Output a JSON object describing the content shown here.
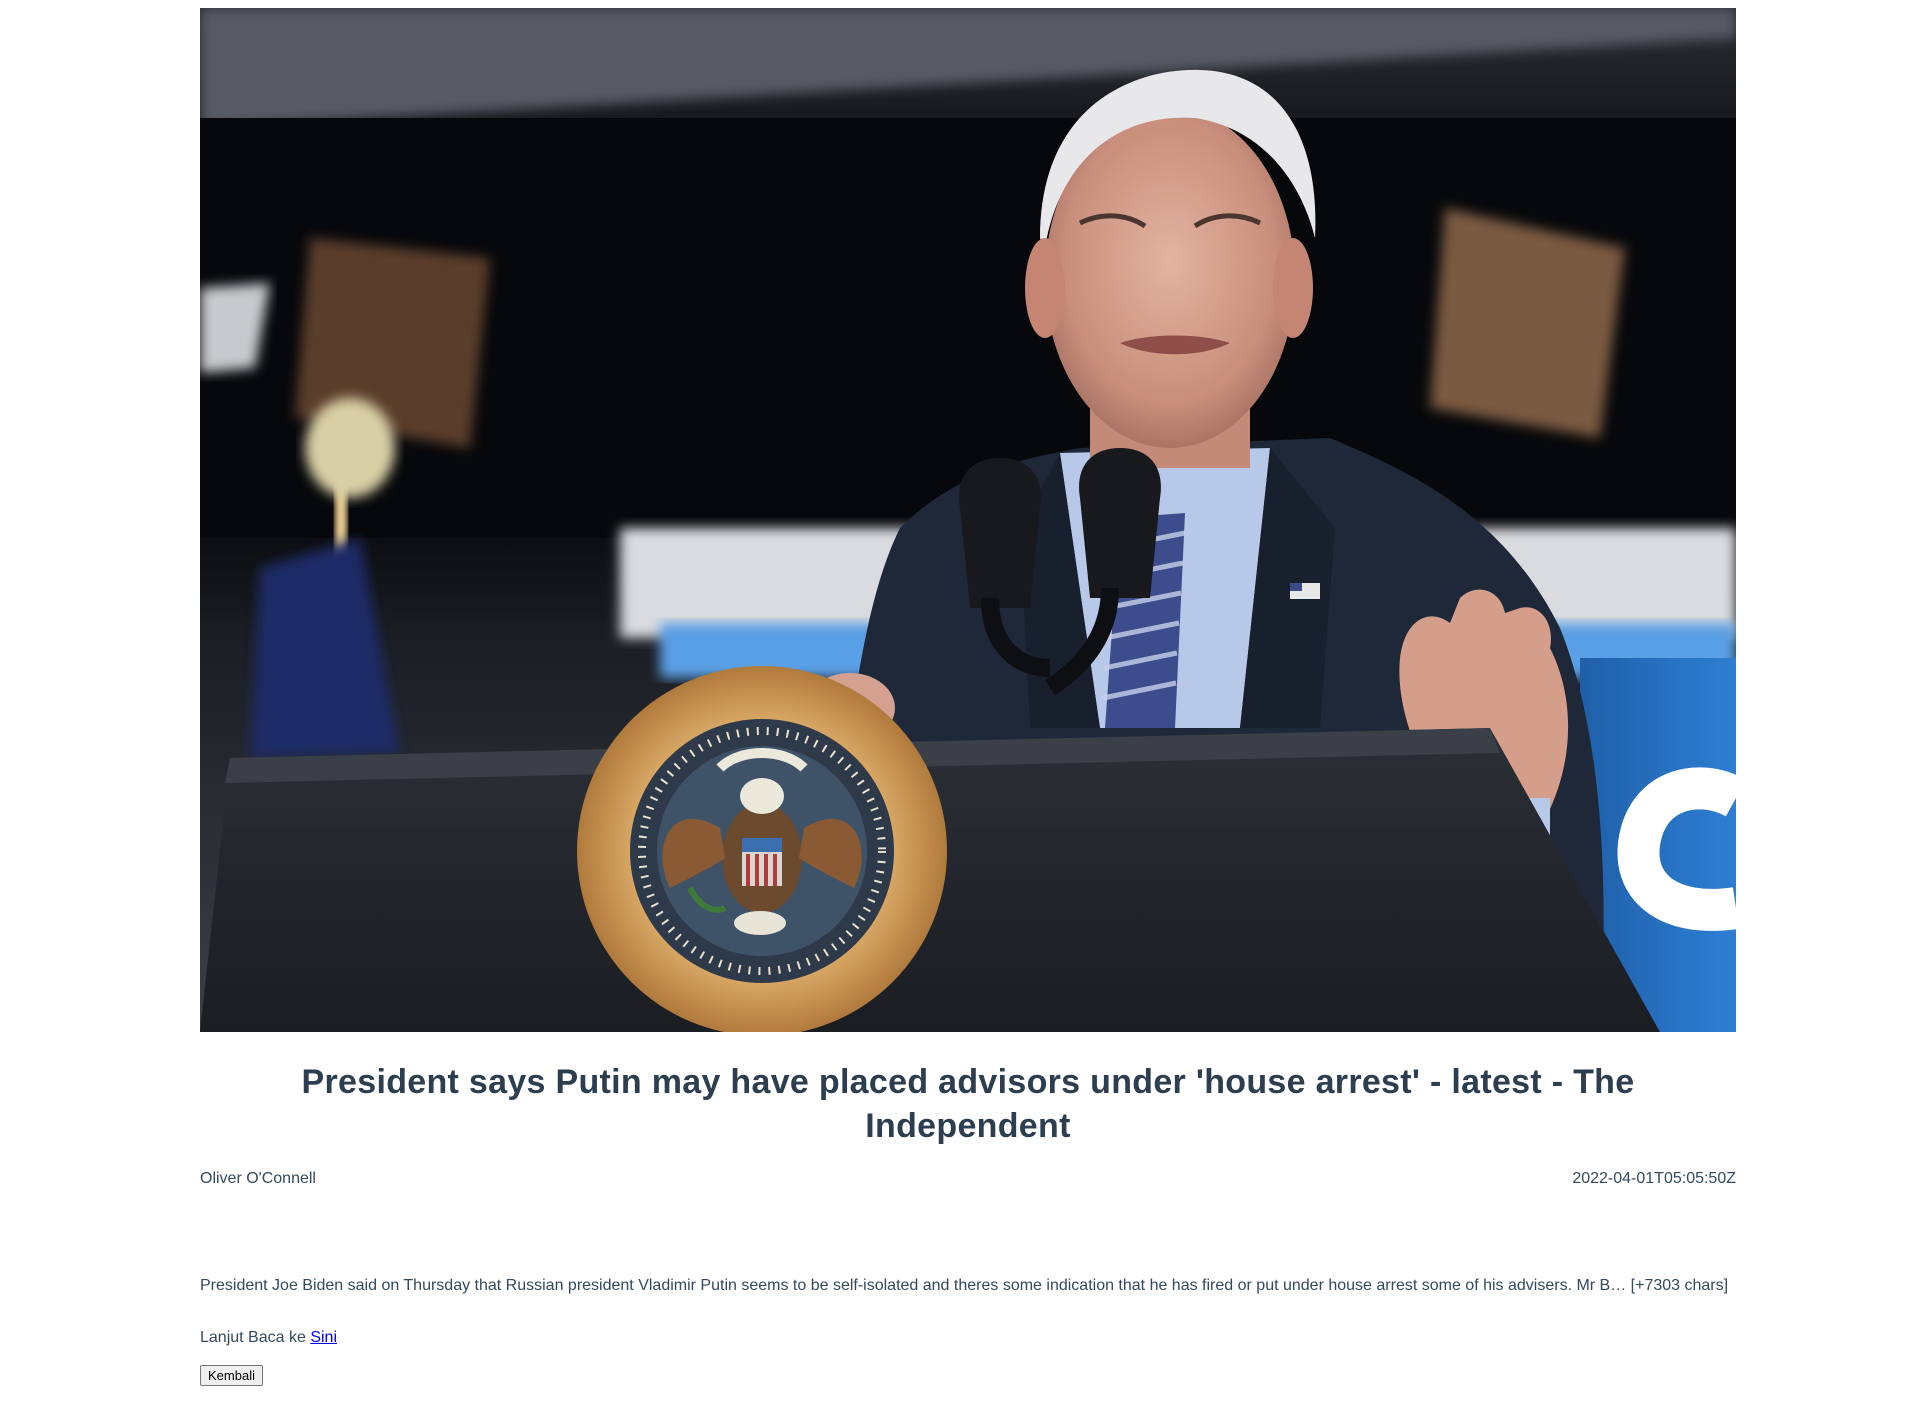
{
  "article": {
    "image_alt": "President Biden speaking at a podium with the presidential seal",
    "title": "President says Putin may have placed advisors under 'house arrest' - latest - The Independent",
    "author": "Oliver O'Connell",
    "published_at": "2022-04-01T05:05:50Z",
    "description": "President Joe Biden said on Thursday that Russian president Vladimir Putin seems to be self-isolated and theres some indication that he has fired or put under house arrest some of his advisers. Mr B… [+7303 chars]",
    "read_more_prefix": "Lanjut Baca ke",
    "read_more_link_text": "Sini",
    "back_button_label": "Kembali"
  },
  "colors": {
    "text": "#34495e",
    "title": "#2c3e50",
    "link": "#0000ee"
  }
}
